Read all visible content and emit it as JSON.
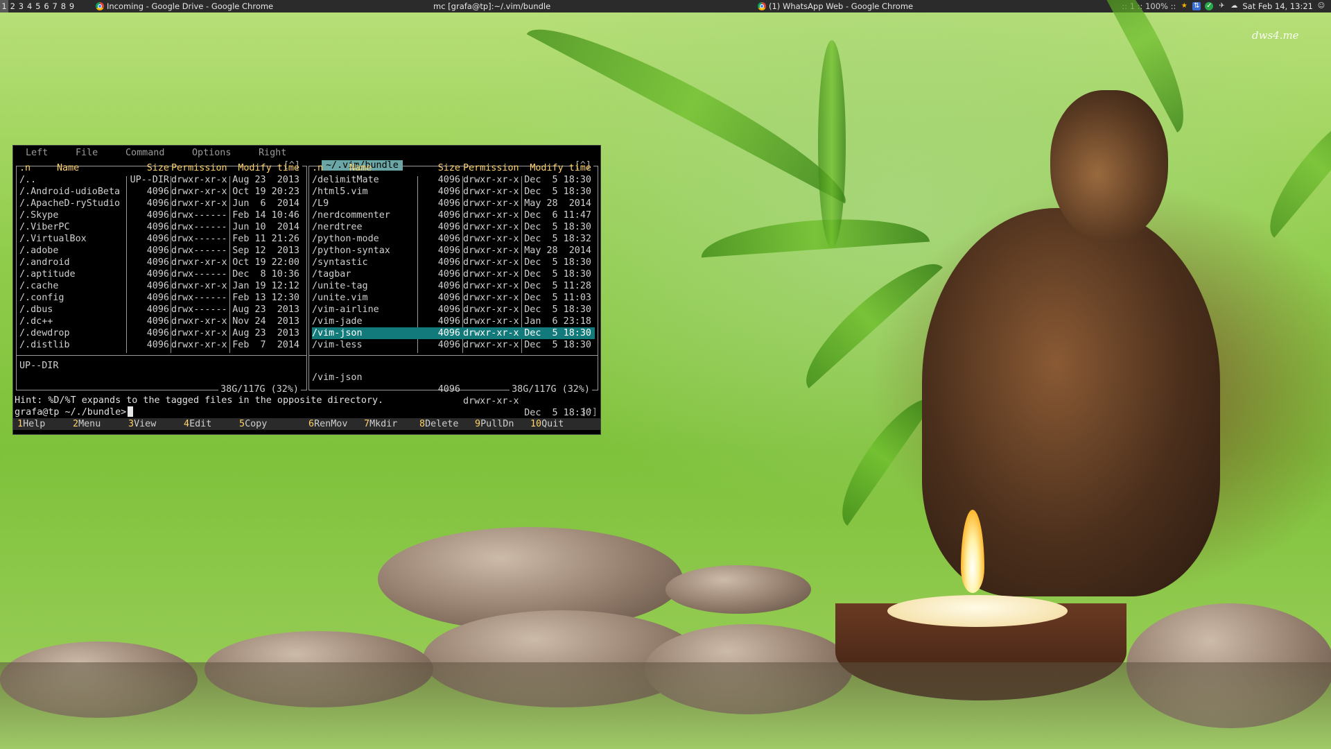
{
  "topbar": {
    "workspaces": [
      "1",
      "2",
      "3",
      "4",
      "5",
      "6",
      "7",
      "8",
      "9"
    ],
    "windows": [
      {
        "title": "Incoming - Google Drive - Google Chrome",
        "icon": "chrome-icon"
      },
      {
        "title": "mc [grafa@tp]:~/.vim/bundle",
        "icon": ""
      },
      {
        "title": "(1) WhatsApp Web - Google Chrome",
        "icon": "chrome-icon"
      }
    ],
    "tray_status": ":: 1 :: 100% ::",
    "clock": "Sat Feb 14, 13:21"
  },
  "wallpaper": {
    "watermark": "dws4.me"
  },
  "mc": {
    "menu": [
      "Left",
      "File",
      "Command",
      "Options",
      "Right"
    ],
    "left_panel": {
      "marker": "[^]",
      "headers": {
        "n": ".n",
        "name": "Name",
        "size": "Size",
        "perm": "Permission",
        "mtime": "Modify time"
      },
      "files": [
        {
          "name": "/..",
          "size": "UP--DIR",
          "perm": "drwxr-xr-x",
          "mtime": "Aug 23  2013"
        },
        {
          "name": "/.Android-udioBeta",
          "size": "4096",
          "perm": "drwxr-xr-x",
          "mtime": "Oct 19 20:23"
        },
        {
          "name": "/.ApacheD-ryStudio",
          "size": "4096",
          "perm": "drwxr-xr-x",
          "mtime": "Jun  6  2014"
        },
        {
          "name": "/.Skype",
          "size": "4096",
          "perm": "drwx------",
          "mtime": "Feb 14 10:46"
        },
        {
          "name": "/.ViberPC",
          "size": "4096",
          "perm": "drwx------",
          "mtime": "Jun 10  2014"
        },
        {
          "name": "/.VirtualBox",
          "size": "4096",
          "perm": "drwx------",
          "mtime": "Feb 11 21:26"
        },
        {
          "name": "/.adobe",
          "size": "4096",
          "perm": "drwx------",
          "mtime": "Sep 12  2013"
        },
        {
          "name": "/.android",
          "size": "4096",
          "perm": "drwxr-xr-x",
          "mtime": "Oct 19 22:00"
        },
        {
          "name": "/.aptitude",
          "size": "4096",
          "perm": "drwx------",
          "mtime": "Dec  8 10:36"
        },
        {
          "name": "/.cache",
          "size": "4096",
          "perm": "drwxr-xr-x",
          "mtime": "Jan 19 12:12"
        },
        {
          "name": "/.config",
          "size": "4096",
          "perm": "drwx------",
          "mtime": "Feb 13 12:30"
        },
        {
          "name": "/.dbus",
          "size": "4096",
          "perm": "drwx------",
          "mtime": "Aug 23  2013"
        },
        {
          "name": "/.dc++",
          "size": "4096",
          "perm": "drwxr-xr-x",
          "mtime": "Nov 24  2013"
        },
        {
          "name": "/.dewdrop",
          "size": "4096",
          "perm": "drwxr-xr-x",
          "mtime": "Aug 23  2013"
        },
        {
          "name": "/.distlib",
          "size": "4096",
          "perm": "drwxr-xr-x",
          "mtime": "Feb  7  2014"
        }
      ],
      "mini_status": "UP--DIR",
      "disk": "38G/117G (32%)"
    },
    "right_panel": {
      "path": "~/.vim/bundle",
      "marker": "[^]",
      "headers": {
        "n": ".n",
        "name": "Name",
        "size": "Size",
        "perm": "Permission",
        "mtime": "Modify time"
      },
      "files": [
        {
          "name": "/delimitMate",
          "size": "4096",
          "perm": "drwxr-xr-x",
          "mtime": "Dec  5 18:30"
        },
        {
          "name": "/html5.vim",
          "size": "4096",
          "perm": "drwxr-xr-x",
          "mtime": "Dec  5 18:30"
        },
        {
          "name": "/L9",
          "size": "4096",
          "perm": "drwxr-xr-x",
          "mtime": "May 28  2014"
        },
        {
          "name": "/nerdcommenter",
          "size": "4096",
          "perm": "drwxr-xr-x",
          "mtime": "Dec  6 11:47"
        },
        {
          "name": "/nerdtree",
          "size": "4096",
          "perm": "drwxr-xr-x",
          "mtime": "Dec  5 18:30"
        },
        {
          "name": "/python-mode",
          "size": "4096",
          "perm": "drwxr-xr-x",
          "mtime": "Dec  5 18:32"
        },
        {
          "name": "/python-syntax",
          "size": "4096",
          "perm": "drwxr-xr-x",
          "mtime": "May 28  2014"
        },
        {
          "name": "/syntastic",
          "size": "4096",
          "perm": "drwxr-xr-x",
          "mtime": "Dec  5 18:30"
        },
        {
          "name": "/tagbar",
          "size": "4096",
          "perm": "drwxr-xr-x",
          "mtime": "Dec  5 18:30"
        },
        {
          "name": "/unite-tag",
          "size": "4096",
          "perm": "drwxr-xr-x",
          "mtime": "Dec  5 11:28"
        },
        {
          "name": "/unite.vim",
          "size": "4096",
          "perm": "drwxr-xr-x",
          "mtime": "Dec  5 11:03"
        },
        {
          "name": "/vim-airline",
          "size": "4096",
          "perm": "drwxr-xr-x",
          "mtime": "Dec  5 18:30"
        },
        {
          "name": "/vim-jade",
          "size": "4096",
          "perm": "drwxr-xr-x",
          "mtime": "Jan  6 23:18"
        },
        {
          "name": "/vim-json",
          "size": "4096",
          "perm": "drwxr-xr-x",
          "mtime": "Dec  5 18:30",
          "selected": true
        },
        {
          "name": "/vim-less",
          "size": "4096",
          "perm": "drwxr-xr-x",
          "mtime": "Dec  5 18:30"
        }
      ],
      "mini_status": {
        "name": "/vim-json",
        "size": "4096",
        "perm": "drwxr-xr-x",
        "mtime": "Dec  5 18:30"
      },
      "disk": "38G/117G (32%)"
    },
    "hint": "Hint: %D/%T expands to the tagged files in the opposite directory.",
    "prompt": "grafa@tp ~/./bundle>",
    "prompt_marker": "[^]",
    "fkeys": [
      {
        "num": "1",
        "label": "Help"
      },
      {
        "num": "2",
        "label": "Menu"
      },
      {
        "num": "3",
        "label": "View"
      },
      {
        "num": "4",
        "label": "Edit"
      },
      {
        "num": "5",
        "label": "Copy"
      },
      {
        "num": "6",
        "label": "RenMov"
      },
      {
        "num": "7",
        "label": "Mkdir"
      },
      {
        "num": "8",
        "label": "Delete"
      },
      {
        "num": "9",
        "label": "PullDn"
      },
      {
        "num": "10",
        "label": "Quit"
      }
    ],
    "colors": {
      "selection": "#127a7a",
      "header": "#ffd36a",
      "path_bg": "#6aa6a6"
    }
  }
}
